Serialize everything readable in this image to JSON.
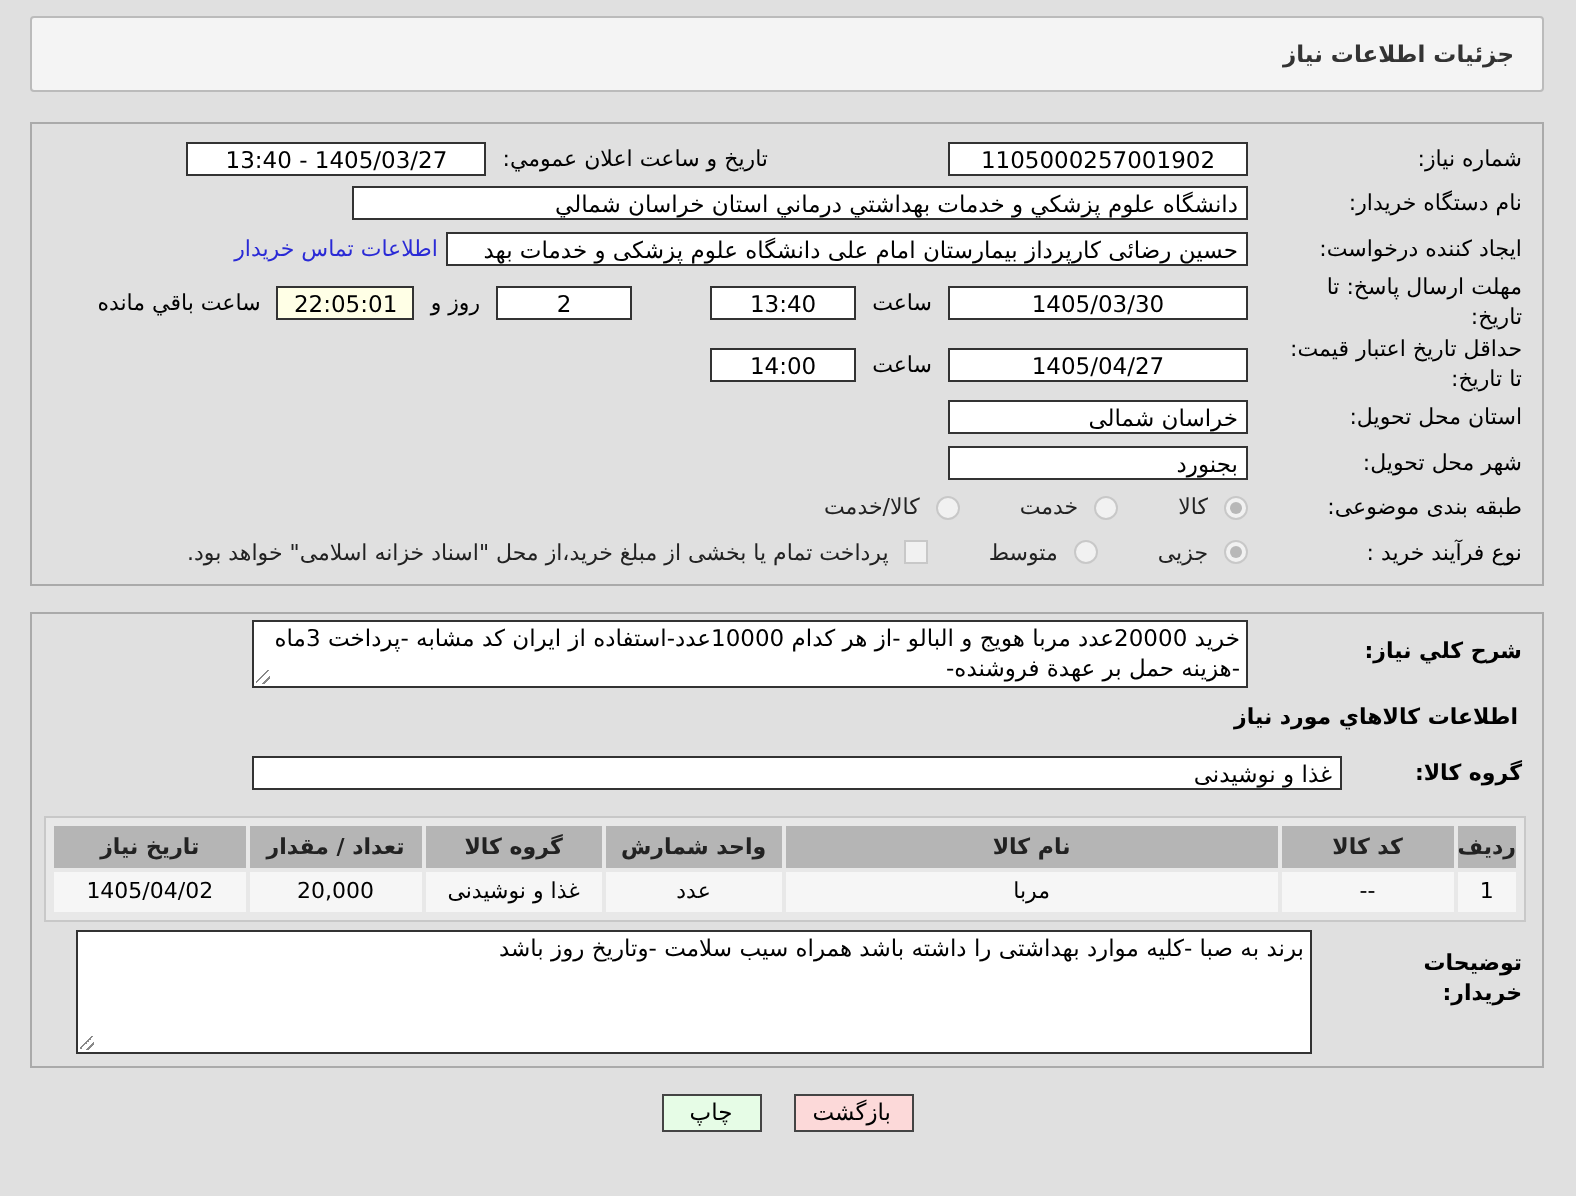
{
  "title": "جزئیات اطلاعات نیاز",
  "need_number": {
    "label": "شماره نیاز:",
    "value": "1105000257001902"
  },
  "announce": {
    "label": "تاریخ و ساعت اعلان عمومي:",
    "value": "1405/03/27 - 13:40"
  },
  "buyer_org": {
    "label": "نام دستگاه خریدار:",
    "value": "دانشگاه علوم پزشكي و خدمات بهداشتي درماني استان خراسان شمالي"
  },
  "requester": {
    "label": "ایجاد کننده درخواست:",
    "value": "حسین رضائی کارپرداز بیمارستان امام علی دانشگاه علوم پزشکی و خدمات بهد",
    "link": "اطلاعات تماس خریدار"
  },
  "deadline": {
    "label": "مهلت ارسال پاسخ: تا تاریخ:",
    "date": "1405/03/30",
    "time_label": "ساعت",
    "time": "13:40",
    "days": "2",
    "days_label": "روز و",
    "remaining": "22:05:01",
    "remaining_label": "ساعت باقي مانده"
  },
  "validity": {
    "label": "حداقل تاریخ اعتبار قیمت: تا تاریخ:",
    "date": "1405/04/27",
    "time_label": "ساعت",
    "time": "14:00"
  },
  "province": {
    "label": "استان محل تحویل:",
    "value": "خراسان شمالی"
  },
  "city": {
    "label": "شهر محل تحویل:",
    "value": "بجنورد"
  },
  "category": {
    "label": "طبقه بندی موضوعی:",
    "options": [
      {
        "label": "کالا",
        "selected": true
      },
      {
        "label": "خدمت",
        "selected": false
      },
      {
        "label": "کالا/خدمت",
        "selected": false
      }
    ]
  },
  "process": {
    "label": "نوع فرآیند خرید :",
    "options": [
      {
        "label": "جزیی",
        "selected": true
      },
      {
        "label": "متوسط",
        "selected": false
      }
    ],
    "payment": {
      "checked": false,
      "text": "پرداخت تمام یا بخشی از مبلغ خرید،از محل \"اسناد خزانه اسلامی\" خواهد بود."
    }
  },
  "description": {
    "label": "شرح کلي نیاز:",
    "value": "خرید 20000عدد مربا هویج و البالو -از هر کدام 10000عدد-استفاده از ایران کد مشابه -پرداخت 3ماه -هزینه حمل بر عهدة فروشنده-"
  },
  "goods_heading": "اطلاعات کالاهاي مورد نیاز",
  "goods_group": {
    "label": "گروه کالا:",
    "value": "غذا و نوشیدنی"
  },
  "table": {
    "columns": [
      "ردیف",
      "کد کالا",
      "نام کالا",
      "واحد شمارش",
      "گروه کالا",
      "تعداد / مقدار",
      "تاریخ نیاز"
    ],
    "rows": [
      [
        "1",
        "--",
        "مربا",
        "عدد",
        "غذا و نوشیدنی",
        "20,000",
        "1405/04/02"
      ]
    ]
  },
  "notes": {
    "label": "توضیحات خریدار:",
    "value": "برند به صبا -کلیه موارد بهداشتی را داشته باشد همراه سیب سلامت -وتاریخ روز باشد"
  },
  "buttons": [
    {
      "label": "بازگشت",
      "kind": "back"
    },
    {
      "label": "چاپ",
      "kind": "print"
    }
  ]
}
